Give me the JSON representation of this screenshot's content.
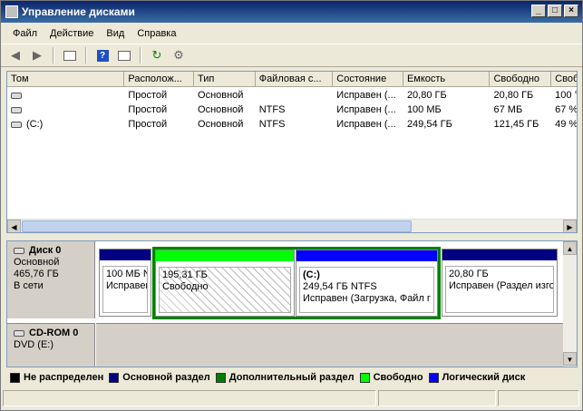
{
  "window": {
    "title": "Управление дисками"
  },
  "menu": [
    "Файл",
    "Действие",
    "Вид",
    "Справка"
  ],
  "columns": [
    "Том",
    "Располож...",
    "Тип",
    "Файловая с...",
    "Состояние",
    "Емкость",
    "Свободно",
    "Своб"
  ],
  "volumes": [
    {
      "name": "",
      "layout": "Простой",
      "type": "Основной",
      "fs": "",
      "status": "Исправен (...",
      "capacity": "20,80 ГБ",
      "free": "20,80 ГБ",
      "pct": "100 °"
    },
    {
      "name": "",
      "layout": "Простой",
      "type": "Основной",
      "fs": "NTFS",
      "status": "Исправен (...",
      "capacity": "100 МБ",
      "free": "67 МБ",
      "pct": "67 %"
    },
    {
      "name": "(C:)",
      "layout": "Простой",
      "type": "Основной",
      "fs": "NTFS",
      "status": "Исправен (...",
      "capacity": "249,54 ГБ",
      "free": "121,45 ГБ",
      "pct": "49 %"
    }
  ],
  "disk0": {
    "name": "Диск 0",
    "type": "Основной",
    "size": "465,76 ГБ",
    "state": "В сети",
    "parts": [
      {
        "line1": "100 МБ N",
        "line2": "Исправен"
      },
      {
        "line1": "195,31 ГБ",
        "line2": "Свободно"
      },
      {
        "title": "(C:)",
        "line1": "249,54 ГБ NTFS",
        "line2": "Исправен (Загрузка, Файл г"
      },
      {
        "line1": "20,80 ГБ",
        "line2": "Исправен (Раздел изго"
      }
    ]
  },
  "cdrom": {
    "name": "CD-ROM 0",
    "type": "DVD (E:)"
  },
  "legend": [
    {
      "label": "Не распределен",
      "color": "#000000"
    },
    {
      "label": "Основной раздел",
      "color": "#000080"
    },
    {
      "label": "Дополнительный раздел",
      "color": "#008000"
    },
    {
      "label": "Свободно",
      "color": "#00ff00"
    },
    {
      "label": "Логический диск",
      "color": "#0000ff"
    }
  ]
}
